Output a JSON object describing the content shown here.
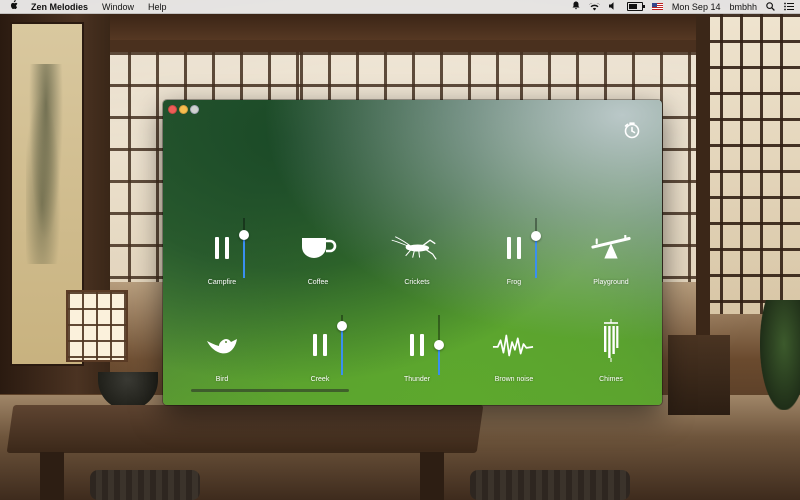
{
  "menubar": {
    "app_name": "Zen Melodies",
    "menus": [
      "Window",
      "Help"
    ],
    "clock": "Mon Sep 14",
    "user": "bmbhh"
  },
  "window": {
    "timer_icon": "timer-icon"
  },
  "sounds": [
    {
      "label": "Campfire",
      "icon": "pause-icon",
      "playing": true,
      "volume": 0.72
    },
    {
      "label": "Coffee",
      "icon": "coffee-cup-icon",
      "playing": false
    },
    {
      "label": "Crickets",
      "icon": "cricket-icon",
      "playing": false
    },
    {
      "label": "Frog",
      "icon": "pause-icon",
      "playing": true,
      "volume": 0.7
    },
    {
      "label": "Playground",
      "icon": "seesaw-icon",
      "playing": false
    },
    {
      "label": "Bird",
      "icon": "bird-icon",
      "playing": false
    },
    {
      "label": "Creek",
      "icon": "pause-icon",
      "playing": true,
      "volume": 0.82
    },
    {
      "label": "Thunder",
      "icon": "pause-icon",
      "playing": true,
      "volume": 0.5
    },
    {
      "label": "Brown noise",
      "icon": "waveform-icon",
      "playing": false
    },
    {
      "label": "Chimes",
      "icon": "wind-chimes-icon",
      "playing": false
    }
  ],
  "colors": {
    "accent": "#3a8ff0",
    "close": "#ee5d57",
    "minimize": "#f6be4f"
  }
}
